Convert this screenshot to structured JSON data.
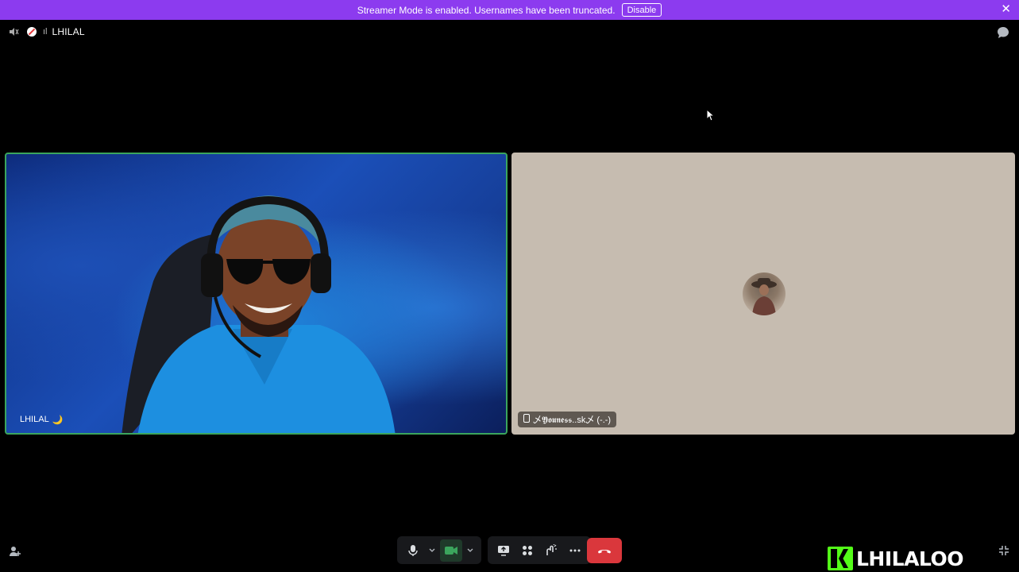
{
  "banner": {
    "message": "Streamer Mode is enabled. Usernames have been truncated.",
    "disable_label": "Disable"
  },
  "topbar": {
    "channel_prefix": "ıl",
    "channel_name": "LHILAL"
  },
  "tiles": [
    {
      "name": "LHILAL",
      "emoji": "🌙",
      "speaking": true
    },
    {
      "name": "乄𝖄𝖔𝖚𝖓𝖊𝖘𝖘..sk乄 (-.-)",
      "device": "mobile"
    }
  ],
  "logo": {
    "text": "LHILALOO"
  },
  "colors": {
    "banner": "#8c3bef",
    "speaking": "#3ba55d",
    "hangup": "#da373c",
    "kick_green": "#53fc18"
  }
}
